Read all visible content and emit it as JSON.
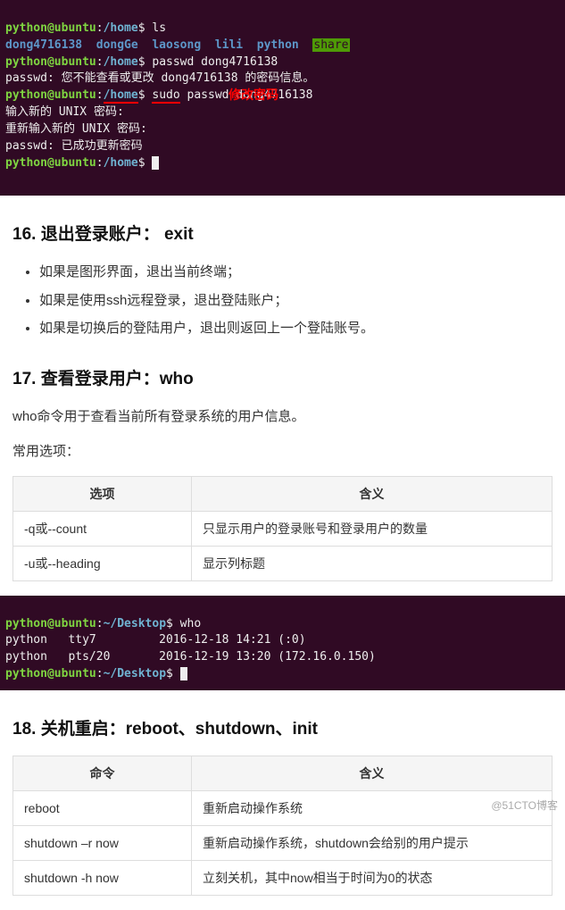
{
  "term1": {
    "l1_prompt": "python@ubuntu",
    "l1_colon": ":",
    "l1_path": "/home",
    "l1_dollar_cmd": "$ ls",
    "l2_items": "dong4716138  dongGe  laosong  lili  python  ",
    "l2_share": "share",
    "l3_prompt": "python@ubuntu",
    "l3_colon": ":",
    "l3_path": "/home",
    "l3_cmd": "$ passwd dong4716138",
    "l4": "passwd: 您不能查看或更改 dong4716138 的密码信息。",
    "l5_prompt": "python@ubuntu",
    "l5_colon": ":",
    "l5_path": "/home",
    "l5_pre": "$ ",
    "l5_sudo": "sudo",
    "l5_rest": " passwd dong4716138",
    "l6": "输入新的 UNIX 密码: ",
    "l7": "重新输入新的 UNIX 密码: ",
    "l8": "passwd: 已成功更新密码",
    "l9_prompt": "python@ubuntu",
    "l9_colon": ":",
    "l9_path": "/home",
    "l9_dollar": "$ ",
    "annot": "修改密码"
  },
  "sec16": {
    "title": "16. 退出登录账户：  exit",
    "b1": "如果是图形界面，退出当前终端；",
    "b2": "如果是使用ssh远程登录，退出登陆账户；",
    "b3": "如果是切换后的登陆用户，退出则返回上一个登陆账号。"
  },
  "sec17": {
    "title": "17. 查看登录用户：who",
    "desc": "who命令用于查看当前所有登录系统的用户信息。",
    "opts_label": "常用选项：",
    "th1": "选项",
    "th2": "含义",
    "r1c1": "-q或--count",
    "r1c2": "只显示用户的登录账号和登录用户的数量",
    "r2c1": "-u或--heading",
    "r2c2": "显示列标题"
  },
  "term2": {
    "l1_prompt": "python@ubuntu",
    "l1_colon": ":",
    "l1_path": "~/Desktop",
    "l1_cmd": "$ who",
    "l2": "python   tty7         2016-12-18 14:21 (:0)",
    "l3": "python   pts/20       2016-12-19 13:20 (172.16.0.150)",
    "l4_prompt": "python@ubuntu",
    "l4_colon": ":",
    "l4_path": "~/Desktop",
    "l4_dollar": "$ "
  },
  "sec18": {
    "title": "18. 关机重启：reboot、shutdown、init",
    "th1": "命令",
    "th2": "含义",
    "r1c1": "reboot",
    "r1c2": "重新启动操作系统",
    "r2c1": "shutdown –r now",
    "r2c2": "重新启动操作系统，shutdown会给别的用户提示",
    "r3c1": "shutdown -h now",
    "r3c2": "立刻关机，其中now相当于时间为0的状态"
  },
  "watermark": "@51CTO博客"
}
